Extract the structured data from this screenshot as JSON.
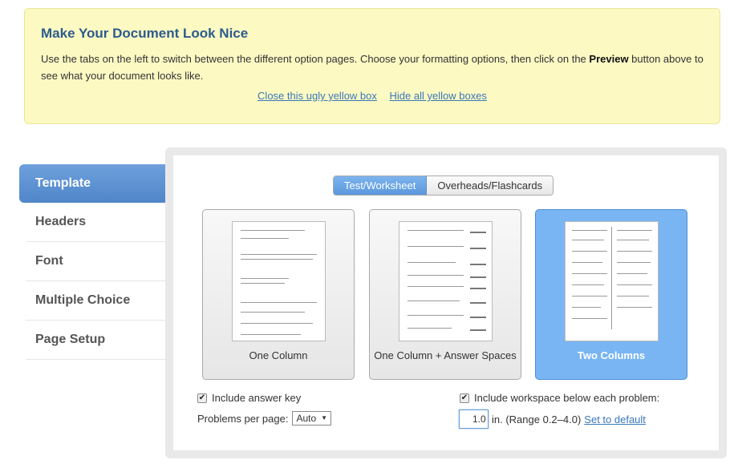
{
  "help": {
    "title": "Make Your Document Look Nice",
    "text_before": "Use the tabs on the left to switch between the different option pages. Choose your formatting options, then click on the ",
    "text_bold": "Preview",
    "text_after": " button above to see what your document looks like.",
    "close_link": "Close this ugly yellow box",
    "hide_link": "Hide all yellow boxes"
  },
  "sidebar": {
    "items": [
      {
        "label": "Template"
      },
      {
        "label": "Headers"
      },
      {
        "label": "Font"
      },
      {
        "label": "Multiple Choice"
      },
      {
        "label": "Page Setup"
      }
    ]
  },
  "toggle": {
    "selected": "Test/Worksheet",
    "other": "Overheads/Flashcards"
  },
  "templates": [
    {
      "label": "One Column"
    },
    {
      "label": "One Column + Answer Spaces"
    },
    {
      "label": "Two Columns"
    }
  ],
  "options": {
    "answer_key_label": "Include answer key",
    "answer_key_checked": true,
    "problems_per_page_label": "Problems per page:",
    "problems_per_page_value": "Auto",
    "workspace_label": "Include workspace below each problem:",
    "workspace_checked": true,
    "workspace_value": "1.0",
    "workspace_unit": "in. (Range 0.2–4.0)",
    "set_default_link": "Set to default"
  },
  "colors": {
    "accent": "#5a8fd0",
    "help_bg": "#fcf9c3",
    "selected_card": "#79b5f3"
  }
}
